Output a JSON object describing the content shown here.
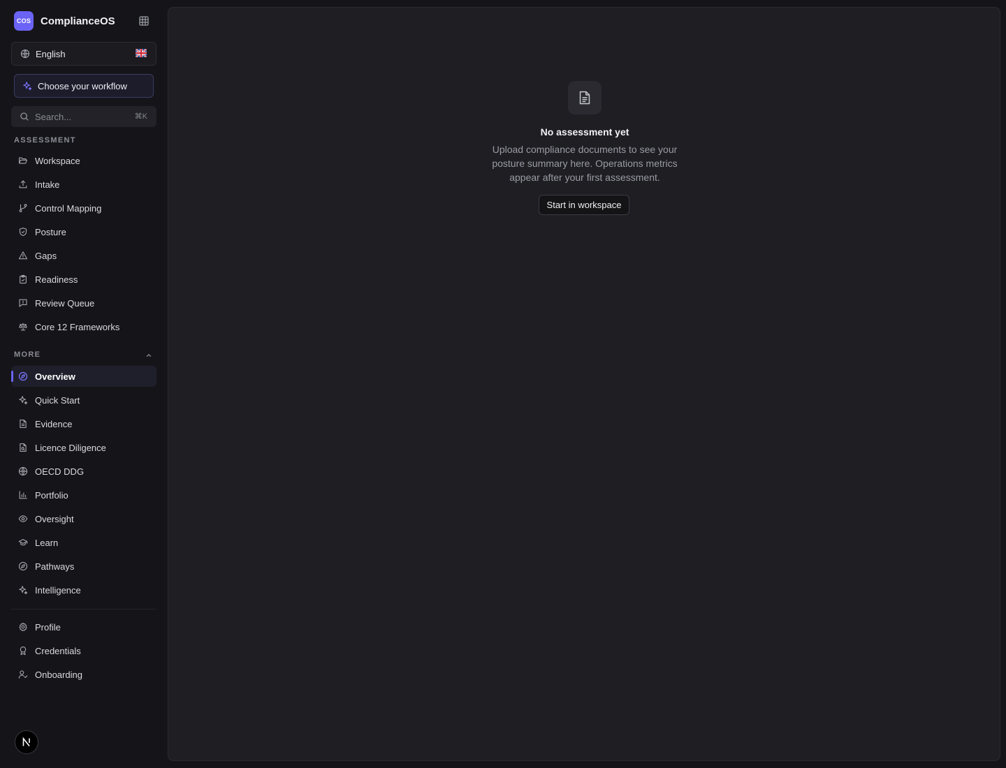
{
  "brand": {
    "logo_text": "COS",
    "name": "ComplianceOS",
    "apps_icon": "grid-icon"
  },
  "language": {
    "label": "English",
    "flag": "uk-flag"
  },
  "workflow": {
    "label": "Choose your workflow"
  },
  "search": {
    "placeholder": "Search...",
    "shortcut": "⌘K"
  },
  "sections": {
    "assessment": "ASSESSMENT",
    "more": "MORE"
  },
  "nav": {
    "assessment": [
      {
        "label": "Workspace",
        "icon": "folder-open-icon"
      },
      {
        "label": "Intake",
        "icon": "upload-icon"
      },
      {
        "label": "Control Mapping",
        "icon": "git-branch-icon"
      },
      {
        "label": "Posture",
        "icon": "shield-icon"
      },
      {
        "label": "Gaps",
        "icon": "warning-triangle-icon"
      },
      {
        "label": "Readiness",
        "icon": "clipboard-check-icon"
      },
      {
        "label": "Review Queue",
        "icon": "message-alert-icon"
      },
      {
        "label": "Core 12 Frameworks",
        "icon": "scale-icon"
      }
    ],
    "more": [
      {
        "label": "Overview",
        "icon": "compass-icon",
        "active": true
      },
      {
        "label": "Quick Start",
        "icon": "sparkles-icon"
      },
      {
        "label": "Evidence",
        "icon": "file-text-icon"
      },
      {
        "label": "Licence Diligence",
        "icon": "file-search-icon"
      },
      {
        "label": "OECD DDG",
        "icon": "globe-icon"
      },
      {
        "label": "Portfolio",
        "icon": "bar-chart-icon"
      },
      {
        "label": "Oversight",
        "icon": "eye-icon"
      },
      {
        "label": "Learn",
        "icon": "graduation-cap-icon"
      },
      {
        "label": "Pathways",
        "icon": "compass-icon"
      },
      {
        "label": "Intelligence",
        "icon": "sparkles-icon"
      }
    ],
    "account": [
      {
        "label": "Profile",
        "icon": "gear-icon"
      },
      {
        "label": "Credentials",
        "icon": "award-icon"
      },
      {
        "label": "Onboarding",
        "icon": "user-check-icon"
      }
    ]
  },
  "avatar": {
    "letter": "N"
  },
  "empty_state": {
    "icon": "file-text-icon",
    "title": "No assessment yet",
    "description": "Upload compliance documents to see your posture summary here. Operations metrics appear after your first assessment.",
    "button": "Start in workspace"
  },
  "colors": {
    "accent": "#6b63f5",
    "background": "#151519",
    "panel": "#1e1e23"
  }
}
